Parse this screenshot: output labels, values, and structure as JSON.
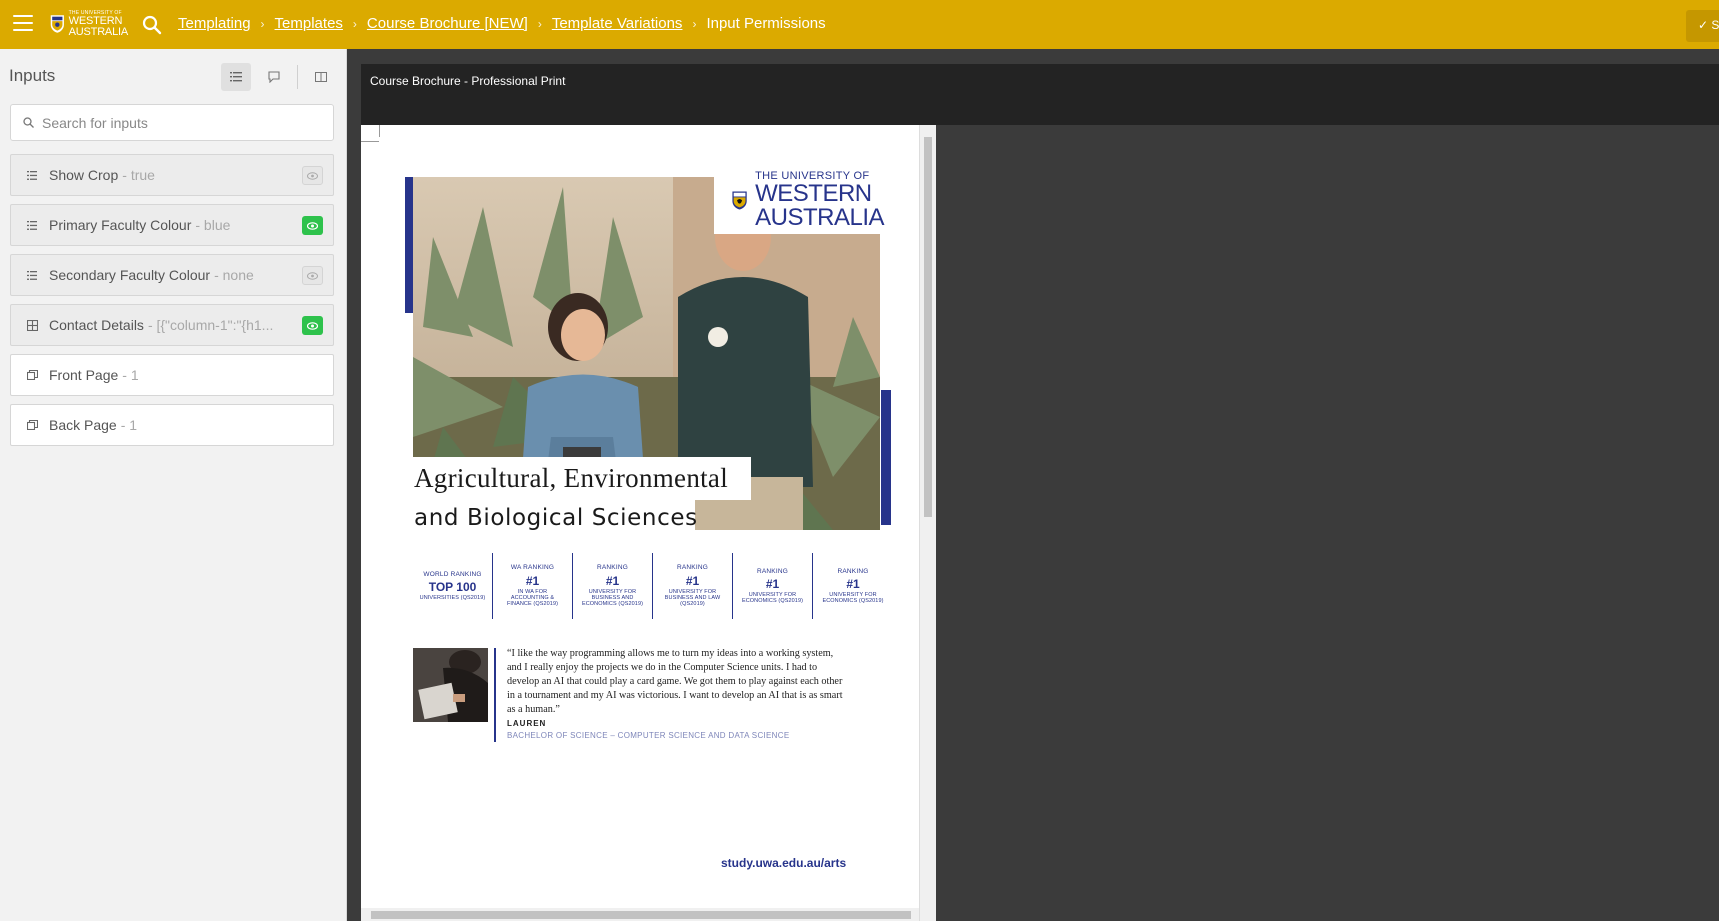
{
  "topbar": {
    "menu_icon": "hamburger-icon",
    "logo": {
      "line1": "THE UNIVERSITY OF",
      "line2": "WESTERN",
      "line3": "AUSTRALIA"
    },
    "search_icon": "search-icon",
    "breadcrumbs": [
      "Templating",
      "Templates",
      "Course Brochure [NEW]",
      "Template Variations"
    ],
    "current": "Input Permissions",
    "save_icon": "check-icon",
    "save_label": "S",
    "accent": "#dbaa00"
  },
  "sidebar": {
    "title": "Inputs",
    "tools": [
      "list-icon",
      "comment-icon",
      "columns-icon"
    ],
    "search": {
      "placeholder": "Search for inputs"
    },
    "inputs": [
      {
        "icon": "list-icon",
        "name": "Show Crop",
        "value": "- true",
        "visible": false
      },
      {
        "icon": "list-icon",
        "name": "Primary Faculty Colour",
        "value": "- blue",
        "visible": true
      },
      {
        "icon": "list-icon",
        "name": "Secondary Faculty Colour",
        "value": "- none",
        "visible": false
      },
      {
        "icon": "table-icon",
        "name": "Contact Details",
        "value": "- [{\"column-1\":\"{h1...",
        "visible": true
      },
      {
        "icon": "pages-icon",
        "name": "Front Page",
        "value": "- 1",
        "visible": null
      },
      {
        "icon": "pages-icon",
        "name": "Back Page",
        "value": "- 1",
        "visible": null
      }
    ]
  },
  "document": {
    "title": "Course Brochure - Professional Print",
    "brochure": {
      "logo": {
        "line1": "THE UNIVERSITY OF",
        "line2": "WESTERN",
        "line3": "AUSTRALIA"
      },
      "title_line1": "Agricultural, Environmental",
      "title_line2": "and Biological Sciences",
      "stats": [
        {
          "kicker": "WORLD RANKING",
          "big": "TOP 100",
          "small": "UNIVERSITIES (QS2019)"
        },
        {
          "kicker": "WA RANKING",
          "big": "#1",
          "small": "IN WA FOR ACCOUNTING & FINANCE (QS2019)"
        },
        {
          "kicker": "RANKING",
          "big": "#1",
          "small": "UNIVERSITY FOR BUSINESS AND ECONOMICS (QS2019)"
        },
        {
          "kicker": "RANKING",
          "big": "#1",
          "small": "UNIVERSITY FOR BUSINESS AND LAW (QS2019)"
        },
        {
          "kicker": "RANKING",
          "big": "#1",
          "small": "UNIVERSITY FOR ECONOMICS (QS2019)"
        },
        {
          "kicker": "RANKING",
          "big": "#1",
          "small": "UNIVERSITY FOR ECONOMICS (QS2019)"
        }
      ],
      "quote": "“I like the way programming allows me to turn my ideas into a working system, and I really enjoy the projects we do in the Computer Science units. I had to develop an AI that could play a card game. We got them to play against each other in a tournament and my AI was victorious. I want to develop an AI that is as smart as a human.”",
      "quote_name": "LAUREN",
      "quote_course": "BACHELOR OF SCIENCE – COMPUTER SCIENCE AND DATA SCIENCE",
      "url": "study.uwa.edu.au/arts",
      "brand_blue": "#27348b"
    }
  }
}
